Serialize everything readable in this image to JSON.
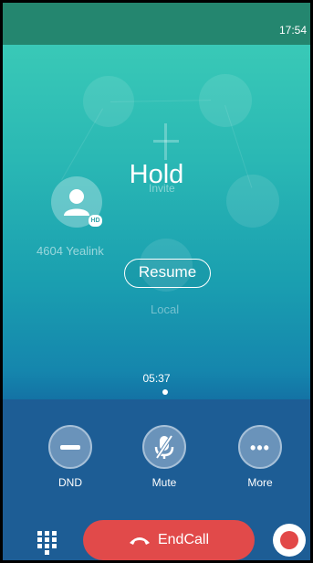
{
  "status_bar": {
    "time": "17:54"
  },
  "call": {
    "state": "Hold",
    "invite_label": "Invite",
    "contact_name": "4604 Yealink",
    "hd_badge": "HD",
    "resume_label": "Resume",
    "local_label": "Local",
    "duration": "05:37"
  },
  "controls": {
    "dnd_label": "DND",
    "mute_label": "Mute",
    "more_label": "More",
    "more_glyph": "•••",
    "endcall_label": "EndCall"
  },
  "icons": [
    "clock",
    "user-avatar-icon",
    "plus-icon",
    "dnd-icon",
    "mute-icon",
    "more-icon",
    "dialpad-icon",
    "hangup-icon",
    "record-icon"
  ],
  "colors": {
    "status_bar": "#24866f",
    "control_panel": "#1d5d95",
    "endcall": "#e14a4a",
    "record": "#e24848"
  }
}
